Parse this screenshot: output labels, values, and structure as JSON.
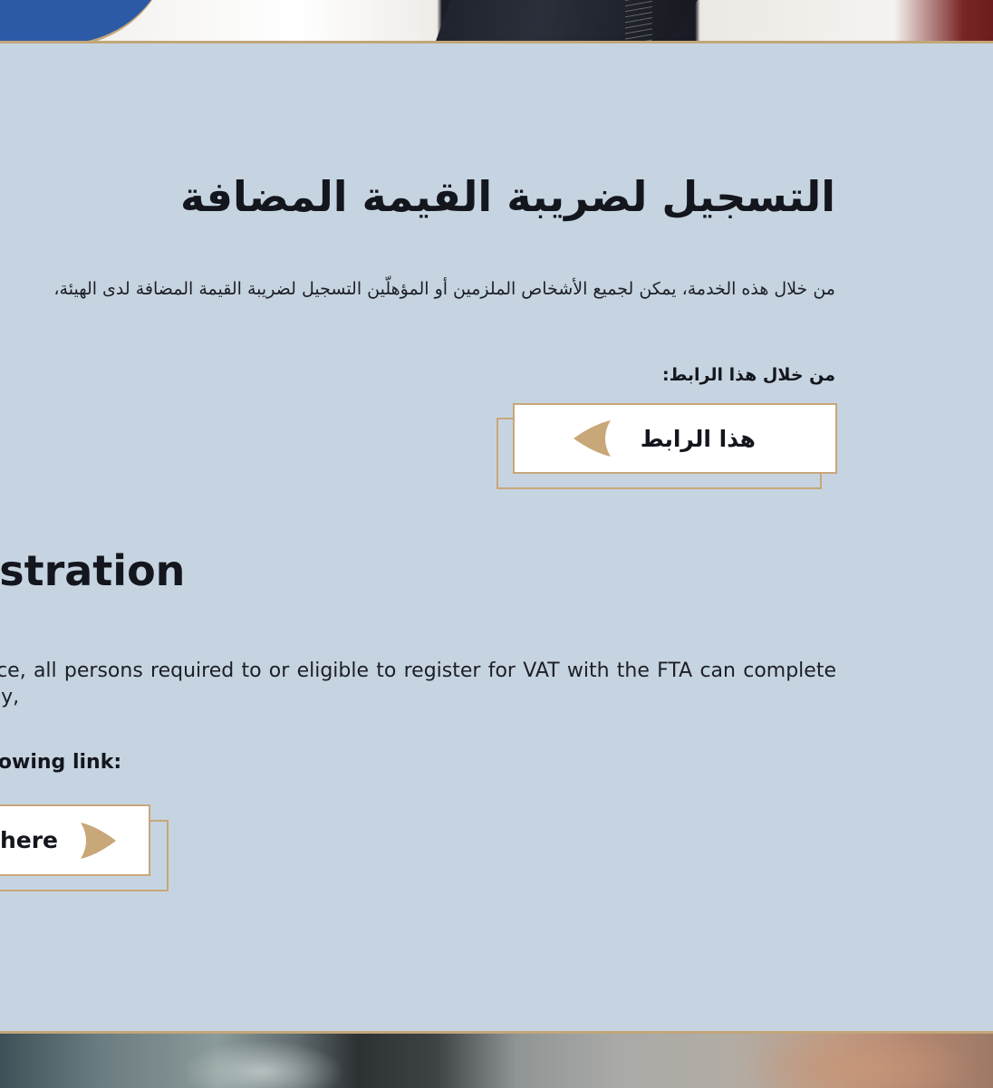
{
  "arabic": {
    "title": "التسجيل لضريبة القيمة المضافة",
    "description": "من خلال هذه الخدمة، يمكن لجميع الأشخاص الملزمين أو المؤهلّين التسجيل لضريبة القيمة المضافة لدى الهيئة،",
    "link_label": "من خلال هذا الرابط:",
    "button_label": "هذا الرابط"
  },
  "english": {
    "title": "VAT Registration",
    "description": "Through this service, all persons required to or eligible to register for VAT with the FTA can complete their registration by,",
    "link_label": "via the following link:",
    "button_label": "Click here"
  },
  "colors": {
    "background": "#c6d4e1",
    "accent_gold": "#c8a779",
    "text": "#14161d",
    "button_bg": "#ffffff"
  },
  "icons": {
    "arabic_button_arrow": "arrow-left-icon",
    "english_button_arrow": "arrow-right-icon"
  }
}
